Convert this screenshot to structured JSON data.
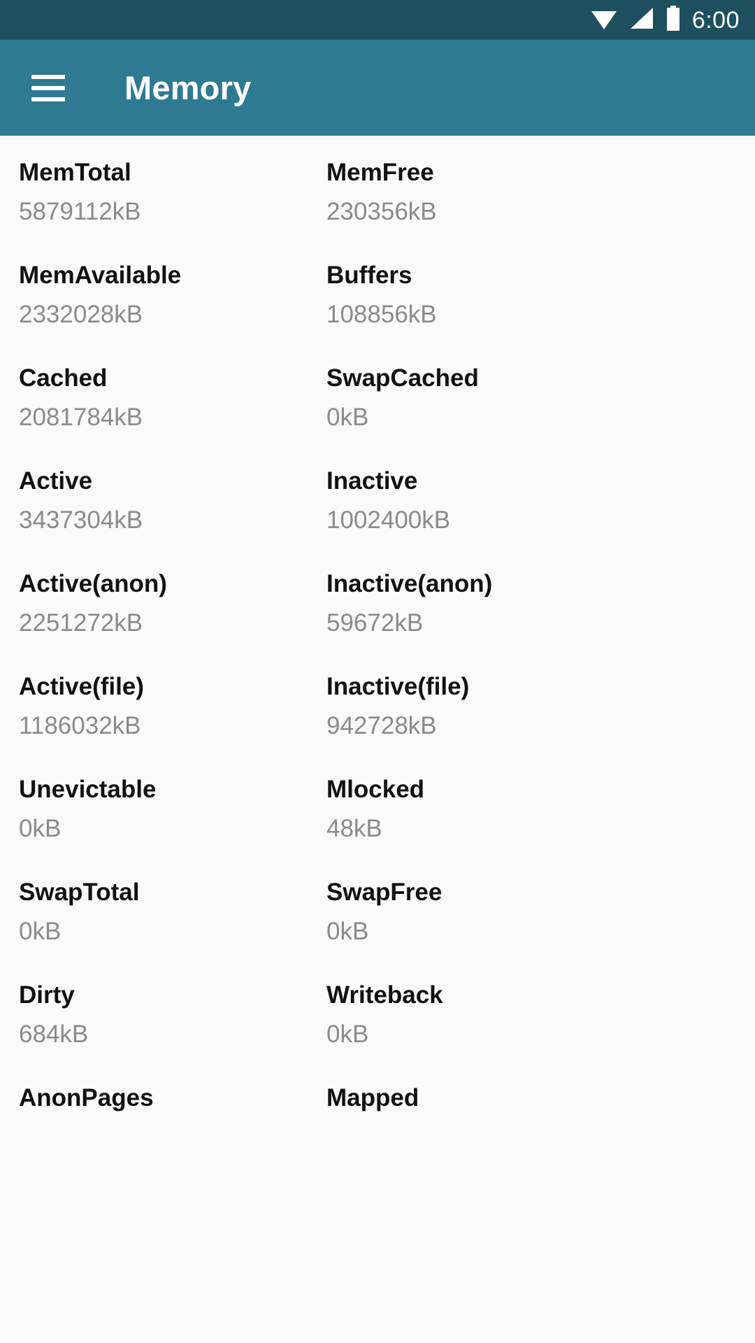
{
  "status_bar": {
    "time": "6:00",
    "icons": [
      "wifi-icon",
      "signal-icon",
      "battery-icon"
    ],
    "background_color": "#1d4f5f"
  },
  "toolbar": {
    "menu_icon": "hamburger-menu-icon",
    "title": "Memory",
    "background_color": "#2d7a92",
    "text_color": "#ffffff"
  },
  "theme": {
    "page_background": "#fafafa",
    "label_color": "#111111",
    "value_color": "#8a8a8a"
  },
  "meminfo": {
    "rows": [
      {
        "left": {
          "label": "MemTotal",
          "value": "5879112kB"
        },
        "right": {
          "label": "MemFree",
          "value": "230356kB"
        }
      },
      {
        "left": {
          "label": "MemAvailable",
          "value": "2332028kB"
        },
        "right": {
          "label": "Buffers",
          "value": "108856kB"
        }
      },
      {
        "left": {
          "label": "Cached",
          "value": "2081784kB"
        },
        "right": {
          "label": "SwapCached",
          "value": "0kB"
        }
      },
      {
        "left": {
          "label": "Active",
          "value": "3437304kB"
        },
        "right": {
          "label": "Inactive",
          "value": "1002400kB"
        }
      },
      {
        "left": {
          "label": "Active(anon)",
          "value": "2251272kB"
        },
        "right": {
          "label": "Inactive(anon)",
          "value": "59672kB"
        }
      },
      {
        "left": {
          "label": "Active(file)",
          "value": "1186032kB"
        },
        "right": {
          "label": "Inactive(file)",
          "value": "942728kB"
        }
      },
      {
        "left": {
          "label": "Unevictable",
          "value": "0kB"
        },
        "right": {
          "label": "Mlocked",
          "value": "48kB"
        }
      },
      {
        "left": {
          "label": "SwapTotal",
          "value": "0kB"
        },
        "right": {
          "label": "SwapFree",
          "value": "0kB"
        }
      },
      {
        "left": {
          "label": "Dirty",
          "value": "684kB"
        },
        "right": {
          "label": "Writeback",
          "value": "0kB"
        }
      },
      {
        "left": {
          "label": "AnonPages",
          "value": ""
        },
        "right": {
          "label": "Mapped",
          "value": ""
        }
      }
    ]
  }
}
